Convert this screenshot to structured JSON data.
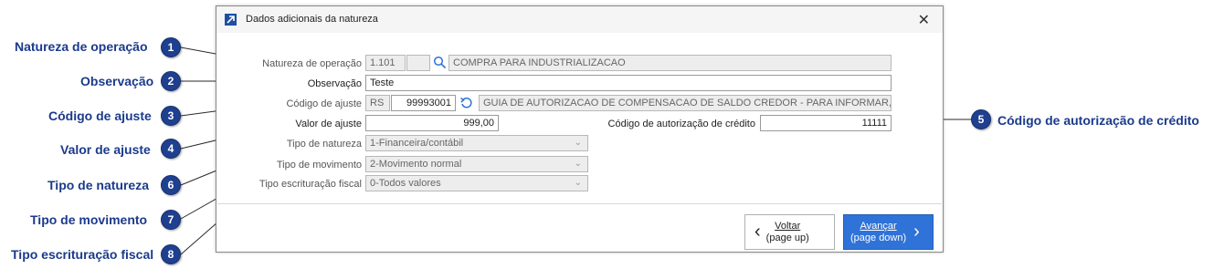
{
  "window": {
    "title": "Dados adicionais da natureza",
    "close_icon": "close-icon",
    "app_icon": "arrow-up-right-icon"
  },
  "form": {
    "natureza_operacao": {
      "label": "Natureza de operação",
      "code": "1.101",
      "sub": "",
      "description": "COMPRA PARA INDUSTRIALIZACAO"
    },
    "observacao": {
      "label": "Observação",
      "value": "Teste"
    },
    "codigo_ajuste": {
      "label": "Código de ajuste",
      "uf": "RS",
      "code": "99993001",
      "description": "GUIA DE AUTORIZACAO DE COMPENSACAO DE SALDO CREDOR - PARA INFORMAR, NO CA"
    },
    "valor_ajuste": {
      "label": "Valor de ajuste",
      "value": "999,00"
    },
    "codigo_autorizacao": {
      "label": "Código de autorização de crédito",
      "value": "11111"
    },
    "tipo_natureza": {
      "label": "Tipo de natureza",
      "value": "1-Financeira/contábil"
    },
    "tipo_movimento": {
      "label": "Tipo de movimento",
      "value": "2-Movimento normal"
    },
    "tipo_escrituracao": {
      "label": "Tipo escrituração fiscal",
      "value": "0-Todos valores"
    }
  },
  "buttons": {
    "back_line1": "Voltar",
    "back_line2": "(page up)",
    "next_line1": "Avançar",
    "next_line2": "(page down)"
  },
  "callouts": [
    {
      "num": "1",
      "text": "Natureza de operação"
    },
    {
      "num": "2",
      "text": "Observação"
    },
    {
      "num": "3",
      "text": "Código de ajuste"
    },
    {
      "num": "4",
      "text": "Valor de ajuste"
    },
    {
      "num": "5",
      "text": "Código de autorização de crédito"
    },
    {
      "num": "6",
      "text": "Tipo de natureza"
    },
    {
      "num": "7",
      "text": "Tipo de movimento"
    },
    {
      "num": "8",
      "text": "Tipo escrituração fiscal"
    }
  ],
  "colors": {
    "callout_text": "#1b3a8c",
    "badge": "#1f3f8f",
    "primary_button": "#2f73d8"
  }
}
